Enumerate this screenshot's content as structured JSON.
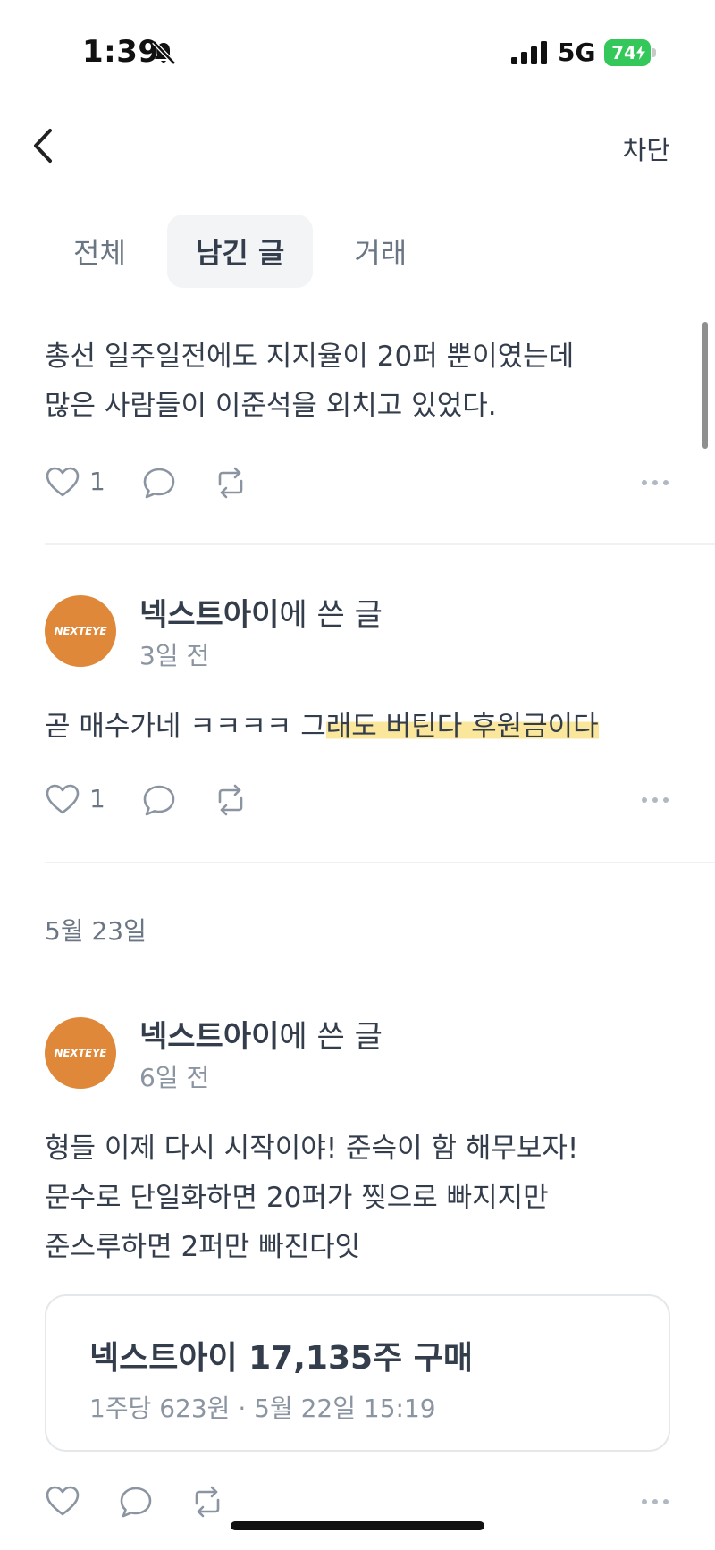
{
  "status_bar": {
    "time": "1:39",
    "network": "5G",
    "battery": "74"
  },
  "header": {
    "block_label": "차단"
  },
  "tabs": [
    {
      "label": "전체",
      "active": false
    },
    {
      "label": "남긴 글",
      "active": true
    },
    {
      "label": "거래",
      "active": false
    }
  ],
  "posts": [
    {
      "text": "총선 일주일전에도 지지율이 20퍼 뿐이였는데\n많은 사람들이 이준석을 외치고 있었다.",
      "likes": "1"
    },
    {
      "author": "넥스트아이",
      "author_suffix": "에 쓴 글",
      "avatar_text": "NEXTEYE",
      "time": "3일 전",
      "text_plain": "곧 매수가네 ㅋㅋㅋㅋ 그",
      "text_highlight": "래도 버틴다 후원금이다",
      "likes": "1"
    },
    {
      "author": "넥스트아이",
      "author_suffix": "에 쓴 글",
      "avatar_text": "NEXTEYE",
      "time": "6일 전",
      "text": "형들 이제 다시 시작이야! 준슥이 함 해무보자!\n문수로 단일화하면 20퍼가 찢으로 빠지지만\n준스루하면 2퍼만 빠진다잇",
      "likes": ""
    }
  ],
  "date_separator": "5월 23일",
  "trade": {
    "title": "넥스트아이 17,135주 구매",
    "subtitle": "1주당 623원 · 5월 22일 15:19"
  },
  "colors": {
    "avatar": "#e0883a",
    "highlight": "#fbe79b",
    "battery": "#34c759"
  }
}
